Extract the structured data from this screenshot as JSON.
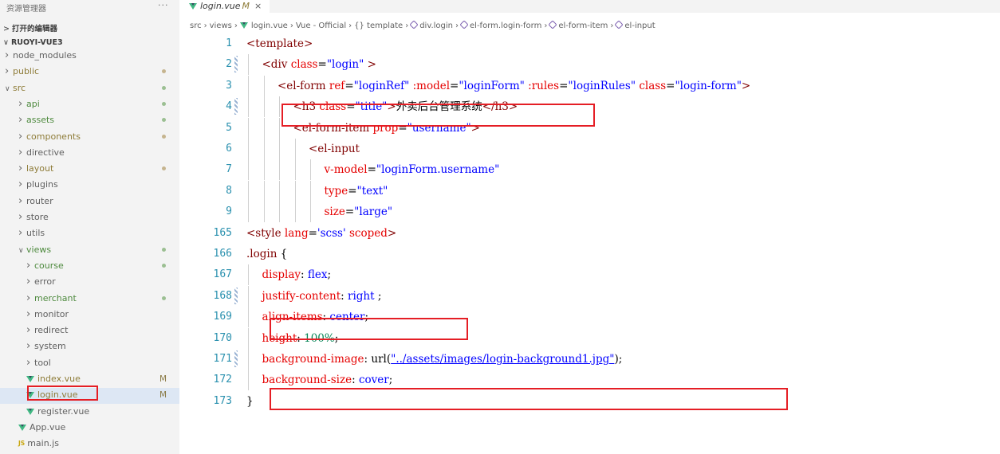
{
  "sidebar": {
    "title": "资源管理器",
    "more": "···",
    "open_editors": "打开的编辑器",
    "project": "RUOYI-VUE3",
    "items": [
      {
        "label": "node_modules",
        "type": "folder",
        "color": "plain",
        "depth": 1
      },
      {
        "label": "public",
        "type": "folder",
        "color": "gold",
        "depth": 1,
        "dot": "gold"
      },
      {
        "label": "src",
        "type": "folder-open",
        "color": "gold",
        "depth": 1,
        "dot": "green"
      },
      {
        "label": "api",
        "type": "folder",
        "color": "green",
        "depth": 2,
        "dot": "green"
      },
      {
        "label": "assets",
        "type": "folder",
        "color": "green",
        "depth": 2,
        "dot": "green"
      },
      {
        "label": "components",
        "type": "folder",
        "color": "gold",
        "depth": 2,
        "dot": "gold"
      },
      {
        "label": "directive",
        "type": "folder",
        "color": "plain",
        "depth": 2
      },
      {
        "label": "layout",
        "type": "folder",
        "color": "gold",
        "depth": 2,
        "dot": "gold"
      },
      {
        "label": "plugins",
        "type": "folder",
        "color": "plain",
        "depth": 2
      },
      {
        "label": "router",
        "type": "folder",
        "color": "plain",
        "depth": 2
      },
      {
        "label": "store",
        "type": "folder",
        "color": "plain",
        "depth": 2
      },
      {
        "label": "utils",
        "type": "folder",
        "color": "plain",
        "depth": 2
      },
      {
        "label": "views",
        "type": "folder-open",
        "color": "green",
        "depth": 2,
        "dot": "green"
      },
      {
        "label": "course",
        "type": "folder",
        "color": "green",
        "depth": 3,
        "dot": "green"
      },
      {
        "label": "error",
        "type": "folder",
        "color": "plain",
        "depth": 3
      },
      {
        "label": "merchant",
        "type": "folder",
        "color": "green",
        "depth": 3,
        "dot": "green"
      },
      {
        "label": "monitor",
        "type": "folder",
        "color": "plain",
        "depth": 3
      },
      {
        "label": "redirect",
        "type": "folder",
        "color": "plain",
        "depth": 3
      },
      {
        "label": "system",
        "type": "folder",
        "color": "plain",
        "depth": 3
      },
      {
        "label": "tool",
        "type": "folder",
        "color": "plain",
        "depth": 3
      },
      {
        "label": "index.vue",
        "type": "vue",
        "color": "gold",
        "depth": 3,
        "status": "M"
      },
      {
        "label": "login.vue",
        "type": "vue",
        "color": "gold",
        "depth": 3,
        "status": "M",
        "selected": true
      },
      {
        "label": "register.vue",
        "type": "vue",
        "color": "plain",
        "depth": 3
      },
      {
        "label": "App.vue",
        "type": "vue",
        "color": "plain",
        "depth": 2
      },
      {
        "label": "main.js",
        "type": "js",
        "color": "plain",
        "depth": 2
      }
    ]
  },
  "tab": {
    "label": "login.vue",
    "status": "M",
    "close": "×"
  },
  "breadcrumb": [
    "src",
    "views",
    "login.vue",
    "Vue - Official",
    "{} template",
    "div.login",
    "el-form.login-form",
    "el-form-item",
    "el-input"
  ],
  "code": [
    {
      "n": "1",
      "indent": 0,
      "parts": [
        [
          "tag",
          "<template>"
        ]
      ]
    },
    {
      "n": "2",
      "indent": 1,
      "mark": true,
      "parts": [
        [
          "tag",
          "<div "
        ],
        [
          "attr",
          "class"
        ],
        [
          "plain",
          "="
        ],
        [
          "val",
          "\"login\""
        ],
        [
          "tag",
          " >"
        ]
      ]
    },
    {
      "n": "3",
      "indent": 2,
      "parts": [
        [
          "tag",
          "<el-form "
        ],
        [
          "attr",
          "ref"
        ],
        [
          "plain",
          "="
        ],
        [
          "val",
          "\"loginRef\""
        ],
        [
          "plain",
          " "
        ],
        [
          "attr",
          ":model"
        ],
        [
          "plain",
          "="
        ],
        [
          "val",
          "\"loginForm\""
        ],
        [
          "plain",
          " "
        ],
        [
          "attr",
          ":rules"
        ],
        [
          "plain",
          "="
        ],
        [
          "val",
          "\"loginRules\""
        ],
        [
          "plain",
          " "
        ],
        [
          "attr",
          "class"
        ],
        [
          "plain",
          "="
        ],
        [
          "val",
          "\"login-form\""
        ],
        [
          "tag",
          ">"
        ]
      ]
    },
    {
      "n": "4",
      "indent": 3,
      "mark": true,
      "parts": [
        [
          "tag",
          "<h3 "
        ],
        [
          "attr",
          "class"
        ],
        [
          "plain",
          "="
        ],
        [
          "val",
          "\"title\""
        ],
        [
          "tag",
          ">"
        ],
        [
          "plain",
          "外卖后台管理系统"
        ],
        [
          "tag",
          "</h3>"
        ]
      ]
    },
    {
      "n": "5",
      "indent": 3,
      "parts": [
        [
          "tag",
          "<el-form-item "
        ],
        [
          "attr",
          "prop"
        ],
        [
          "plain",
          "="
        ],
        [
          "val",
          "\"username\""
        ],
        [
          "tag",
          ">"
        ]
      ]
    },
    {
      "n": "6",
      "indent": 4,
      "parts": [
        [
          "tag",
          "<el-input"
        ]
      ]
    },
    {
      "n": "7",
      "indent": 5,
      "parts": [
        [
          "attr",
          "v-model"
        ],
        [
          "plain",
          "="
        ],
        [
          "val",
          "\"loginForm.username\""
        ]
      ]
    },
    {
      "n": "8",
      "indent": 5,
      "parts": [
        [
          "attr",
          "type"
        ],
        [
          "plain",
          "="
        ],
        [
          "val",
          "\"text\""
        ]
      ]
    },
    {
      "n": "9",
      "indent": 5,
      "parts": [
        [
          "attr",
          "size"
        ],
        [
          "plain",
          "="
        ],
        [
          "val",
          "\"large\""
        ]
      ]
    },
    {
      "n": "165",
      "indent": 0,
      "parts": [
        [
          "tag",
          "<style "
        ],
        [
          "attr",
          "lang"
        ],
        [
          "plain",
          "="
        ],
        [
          "val",
          "'scss'"
        ],
        [
          "plain",
          " "
        ],
        [
          "attr",
          "scoped"
        ],
        [
          "tag",
          ">"
        ]
      ]
    },
    {
      "n": "166",
      "indent": 0,
      "parts": [
        [
          "tag",
          ".login"
        ],
        [
          "plain",
          " {"
        ]
      ]
    },
    {
      "n": "167",
      "indent": 1,
      "parts": [
        [
          "prop",
          "display"
        ],
        [
          "plain",
          ": "
        ],
        [
          "val",
          "flex"
        ],
        [
          "plain",
          ";"
        ]
      ]
    },
    {
      "n": "168",
      "indent": 1,
      "mark": true,
      "parts": [
        [
          "prop",
          "justify-content"
        ],
        [
          "plain",
          ": "
        ],
        [
          "val",
          "right"
        ],
        [
          "plain",
          " ;"
        ]
      ]
    },
    {
      "n": "169",
      "indent": 1,
      "parts": [
        [
          "prop",
          "align-items"
        ],
        [
          "plain",
          ": "
        ],
        [
          "val",
          "center"
        ],
        [
          "plain",
          ";"
        ]
      ]
    },
    {
      "n": "170",
      "indent": 1,
      "parts": [
        [
          "prop",
          "height"
        ],
        [
          "plain",
          ": "
        ],
        [
          "num",
          "100%"
        ],
        [
          "plain",
          ";"
        ]
      ]
    },
    {
      "n": "171",
      "indent": 1,
      "mark": true,
      "parts": [
        [
          "prop",
          "background-image"
        ],
        [
          "plain",
          ": url("
        ],
        [
          "under",
          "\"../assets/images/login-background1.jpg\""
        ],
        [
          "plain",
          ");"
        ]
      ]
    },
    {
      "n": "172",
      "indent": 1,
      "parts": [
        [
          "prop",
          "background-size"
        ],
        [
          "plain",
          ": "
        ],
        [
          "val",
          "cover"
        ],
        [
          "plain",
          ";"
        ]
      ]
    },
    {
      "n": "173",
      "indent": 0,
      "parts": [
        [
          "plain",
          "}"
        ]
      ]
    }
  ],
  "colors": {
    "highlight": "#e51e25",
    "tag": "#800000",
    "attr": "#e50000",
    "value": "#0000ff",
    "line_number": "#2b91af"
  }
}
